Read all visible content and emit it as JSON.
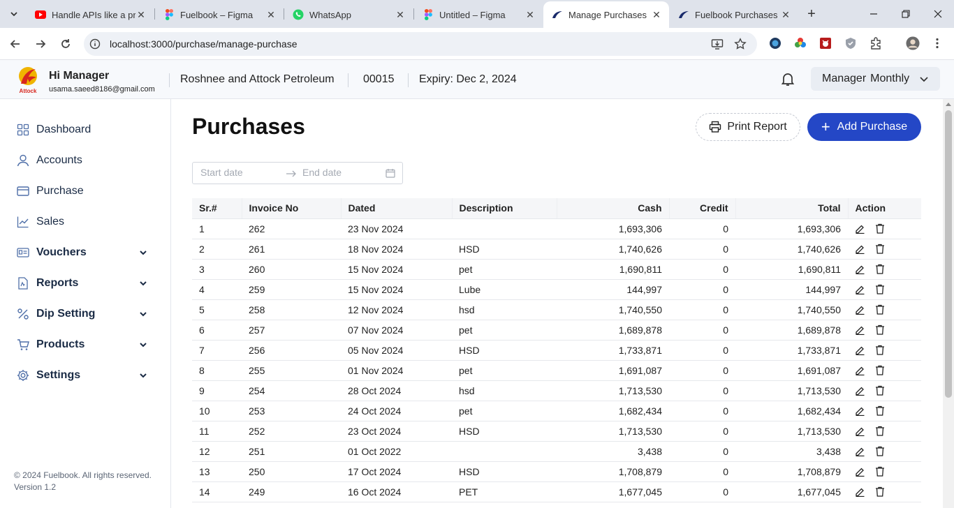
{
  "browser": {
    "tabs": [
      {
        "title": "Handle APIs like a pro",
        "favicon": "youtube-icon",
        "active": false
      },
      {
        "title": "Fuelbook – Figma",
        "favicon": "figma-icon",
        "active": false
      },
      {
        "title": "WhatsApp",
        "favicon": "whatsapp-icon",
        "active": false
      },
      {
        "title": "Untitled – Figma",
        "favicon": "figma-icon",
        "active": false
      },
      {
        "title": "Manage Purchases",
        "favicon": "fuelbook-icon",
        "active": true
      },
      {
        "title": "Fuelbook Purchases",
        "favicon": "fuelbook-icon",
        "active": false
      }
    ],
    "url": "localhost:3000/purchase/manage-purchase"
  },
  "header": {
    "greeting": "Hi Manager",
    "email": "usama.saeed8186@gmail.com",
    "logo_text": "Attock",
    "company": "Roshnee and Attock Petroleum",
    "code": "00015",
    "expiry": "Expiry: Dec 2, 2024",
    "plan_role": "Manager",
    "plan_period": "Monthly"
  },
  "sidebar": {
    "items": [
      {
        "label": "Dashboard",
        "icon": "grid-icon",
        "bold": false,
        "expandable": false
      },
      {
        "label": "Accounts",
        "icon": "user-icon",
        "bold": false,
        "expandable": false
      },
      {
        "label": "Purchase",
        "icon": "card-icon",
        "bold": false,
        "expandable": false
      },
      {
        "label": "Sales",
        "icon": "chart-line-icon",
        "bold": false,
        "expandable": false
      },
      {
        "label": "Vouchers",
        "icon": "voucher-icon",
        "bold": true,
        "expandable": true
      },
      {
        "label": "Reports",
        "icon": "report-icon",
        "bold": true,
        "expandable": true
      },
      {
        "label": "Dip Setting",
        "icon": "percent-icon",
        "bold": true,
        "expandable": true
      },
      {
        "label": "Products",
        "icon": "cart-icon",
        "bold": true,
        "expandable": true
      },
      {
        "label": "Settings",
        "icon": "gear-icon",
        "bold": true,
        "expandable": true
      }
    ],
    "copyright": "© 2024 Fuelbook. All rights reserved.",
    "version": "Version 1.2"
  },
  "main": {
    "title": "Purchases",
    "print_label": "Print Report",
    "add_label": "Add Purchase",
    "date_start_placeholder": "Start date",
    "date_end_placeholder": "End date",
    "columns": [
      "Sr.#",
      "Invoice No",
      "Dated",
      "Description",
      "Cash",
      "Credit",
      "Total",
      "Action"
    ],
    "rows": [
      [
        "1",
        "262",
        "23 Nov 2024",
        "",
        "1,693,306",
        "0",
        "1,693,306"
      ],
      [
        "2",
        "261",
        "18 Nov 2024",
        "HSD",
        "1,740,626",
        "0",
        "1,740,626"
      ],
      [
        "3",
        "260",
        "15 Nov 2024",
        "pet",
        "1,690,811",
        "0",
        "1,690,811"
      ],
      [
        "4",
        "259",
        "15 Nov 2024",
        "Lube",
        "144,997",
        "0",
        "144,997"
      ],
      [
        "5",
        "258",
        "12 Nov 2024",
        "hsd",
        "1,740,550",
        "0",
        "1,740,550"
      ],
      [
        "6",
        "257",
        "07 Nov 2024",
        "pet",
        "1,689,878",
        "0",
        "1,689,878"
      ],
      [
        "7",
        "256",
        "05 Nov 2024",
        "HSD",
        "1,733,871",
        "0",
        "1,733,871"
      ],
      [
        "8",
        "255",
        "01 Nov 2024",
        "pet",
        "1,691,087",
        "0",
        "1,691,087"
      ],
      [
        "9",
        "254",
        "28 Oct 2024",
        "hsd",
        "1,713,530",
        "0",
        "1,713,530"
      ],
      [
        "10",
        "253",
        "24 Oct 2024",
        "pet",
        "1,682,434",
        "0",
        "1,682,434"
      ],
      [
        "11",
        "252",
        "23 Oct 2024",
        "HSD",
        "1,713,530",
        "0",
        "1,713,530"
      ],
      [
        "12",
        "251",
        "01 Oct 2022",
        "",
        "3,438",
        "0",
        "3,438"
      ],
      [
        "13",
        "250",
        "17 Oct 2024",
        "HSD",
        "1,708,879",
        "0",
        "1,708,879"
      ],
      [
        "14",
        "249",
        "16 Oct 2024",
        "PET",
        "1,677,045",
        "0",
        "1,677,045"
      ]
    ]
  },
  "colors": {
    "primary": "#2447c6",
    "sidebar_text": "#1a2b45",
    "tab_strip": "#dfe3eb"
  }
}
